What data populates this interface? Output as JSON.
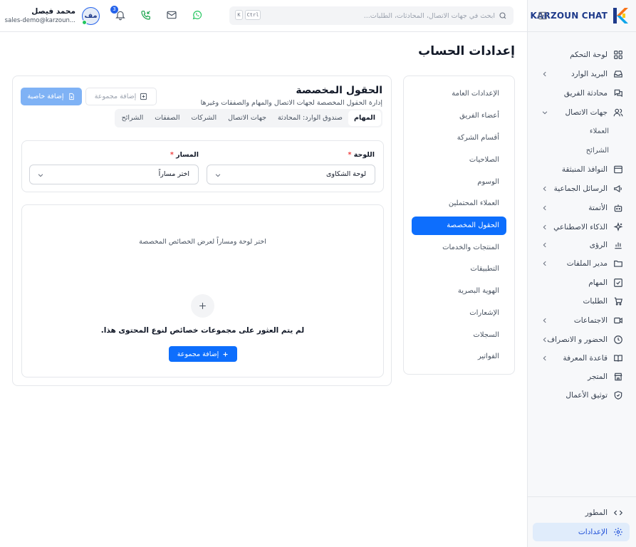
{
  "brand": {
    "name": "KARZOUN CHAT"
  },
  "sidebar": {
    "items": [
      {
        "key": "dashboard",
        "label": "لوحة التحكم"
      },
      {
        "key": "inbox",
        "label": "البريد الوارد"
      },
      {
        "key": "team-chat",
        "label": "محادثة الفريق"
      },
      {
        "key": "contacts",
        "label": "جهات الاتصال"
      },
      {
        "key": "popups",
        "label": "النوافذ المنبثقة"
      },
      {
        "key": "broadcast",
        "label": "الرسائل الجماعية"
      },
      {
        "key": "automation",
        "label": "الأتمتة"
      },
      {
        "key": "ai",
        "label": "الذكاء الاصطناعي"
      },
      {
        "key": "insights",
        "label": "الرؤى"
      },
      {
        "key": "file-manager",
        "label": "مدير الملفات"
      },
      {
        "key": "tasks",
        "label": "المهام"
      },
      {
        "key": "orders",
        "label": "الطلبات"
      },
      {
        "key": "meetings",
        "label": "الاجتماعات"
      },
      {
        "key": "attendance",
        "label": "الحضور و الانصراف"
      },
      {
        "key": "knowledge-base",
        "label": "قاعدة المعرفة"
      },
      {
        "key": "store",
        "label": "المتجر"
      },
      {
        "key": "business-verification",
        "label": "توثيق الأعمال"
      }
    ],
    "contacts_sub": [
      "العملاء",
      "الشرائح"
    ],
    "bottom": [
      {
        "key": "developer",
        "label": "المطور"
      },
      {
        "key": "settings",
        "label": "الإعدادات"
      }
    ]
  },
  "header": {
    "search_placeholder": "ابحث في جهات الاتصال، المحادثات، الطلبات...",
    "kbd_ctrl": "Ctrl",
    "kbd_k": "K",
    "notification_count": "3",
    "user": {
      "name": "محمد فيصل",
      "email": "sales-demo@karzoun...",
      "initials": "مف"
    }
  },
  "page": {
    "title": "إعدادات الحساب"
  },
  "settings_menu": [
    "الإعدادات العامة",
    "أعضاء الفريق",
    "أقسام الشركة",
    "الصلاحيات",
    "الوسوم",
    "العملاء المحتملين",
    "الحقول المخصصة",
    "المنتجات والخدمات",
    "التطبيقات",
    "الهوية البصرية",
    "الإشعارات",
    "السجلات",
    "الفواتير"
  ],
  "custom_fields": {
    "title": "الحقول المخصصة",
    "description": "إدارة الحقول المخصصة لجهات الاتصال والمهام والصفقات وغيرها",
    "add_property": "إضافة خاصية",
    "add_group": "إضافة مجموعة",
    "tabs": [
      "المهام",
      "صندوق الوارد: المحادثة",
      "جهات الاتصال",
      "الشركات",
      "الصفقات",
      "الشرائح"
    ],
    "board_label": "اللوحة",
    "board_value": "لوحة الشكاوى",
    "pipeline_label": "المسار",
    "pipeline_value": "اختر مساراً",
    "empty_hint": "اختر لوحة ومساراً لعرض الخصائص المخصصة",
    "empty_title": "لم يتم العثور على مجموعات خصائص لنوع المحتوى هذا.",
    "empty_button": "إضافة مجموعة"
  },
  "colors": {
    "accent": "#0d6efd",
    "brand": "#1e3a8a",
    "whatsapp": "#22c55e"
  }
}
